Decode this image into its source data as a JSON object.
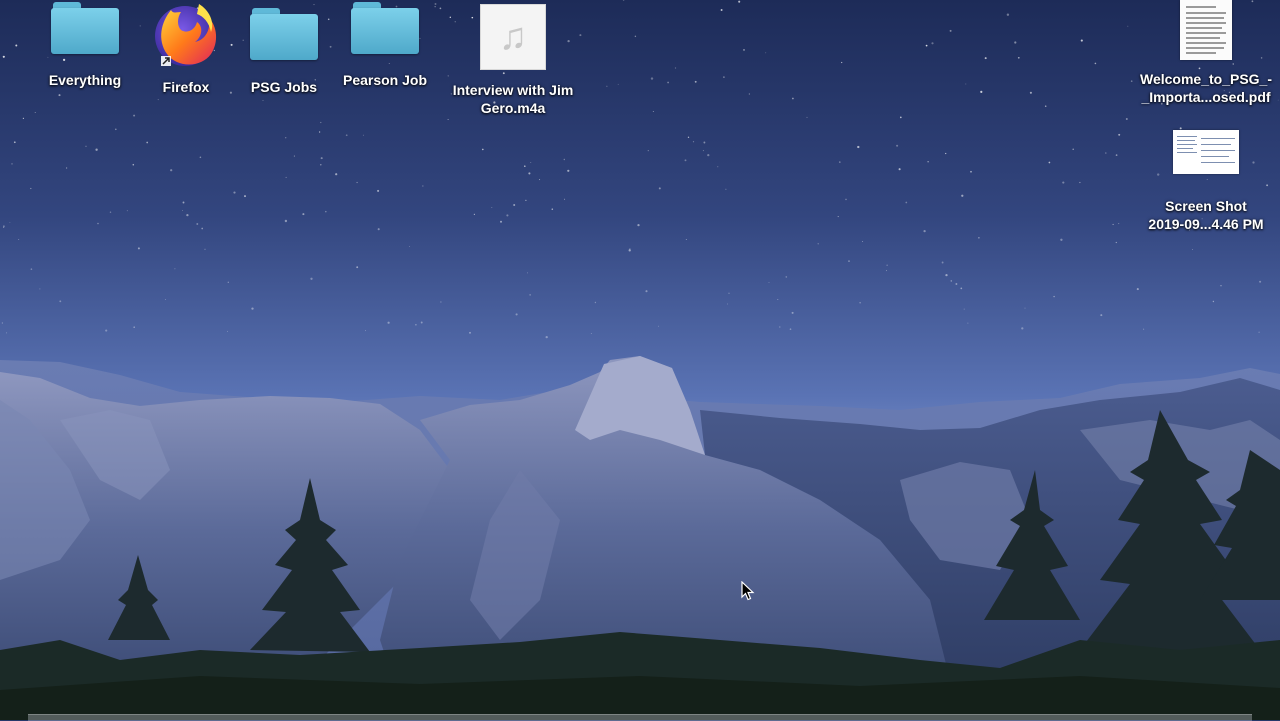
{
  "desktop": {
    "icons": [
      {
        "label": "Everything",
        "kind": "folder",
        "icon": "folder-icon"
      },
      {
        "label": "Firefox",
        "kind": "application",
        "icon": "firefox-icon",
        "alias": true
      },
      {
        "label": "PSG Jobs",
        "kind": "folder",
        "icon": "folder-icon"
      },
      {
        "label": "Pearson Job",
        "kind": "folder",
        "icon": "folder-icon"
      },
      {
        "label_line1": "Interview with Jim",
        "label_line2": "Gero.m4a",
        "kind": "audio-file",
        "icon": "music-note-icon"
      },
      {
        "label_line1": "Welcome_to_PSG_-",
        "label_line2": "_Importa...osed.pdf",
        "kind": "pdf-file",
        "icon": "pdf-document-icon"
      },
      {
        "label_line1": "Screen Shot",
        "label_line2": "2019-09...4.46 PM",
        "kind": "image-file",
        "icon": "screenshot-thumbnail-icon"
      }
    ]
  },
  "wallpaper": {
    "scene": "mountain-valley-dusk",
    "sky_top": "#1e2d5c",
    "sky_bottom": "#6d86c4"
  },
  "colors": {
    "folder": "#6cc4e4",
    "label_text": "#ffffff"
  }
}
